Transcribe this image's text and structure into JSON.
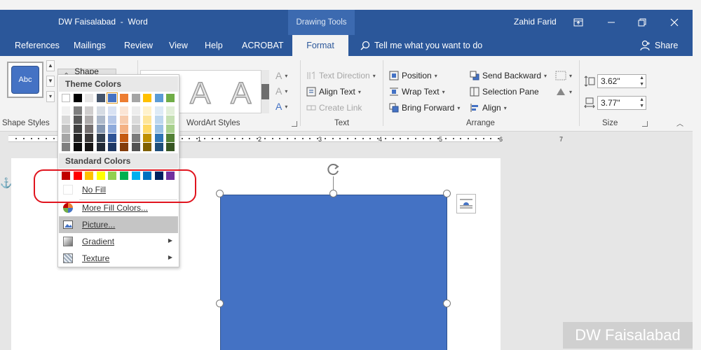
{
  "title_bar": {
    "document_title": "DW Faisalabad  -  Word",
    "contextual_tab_group": "Drawing Tools",
    "user_name": "Zahid Farid"
  },
  "tabs": [
    {
      "label": "References"
    },
    {
      "label": "Mailings"
    },
    {
      "label": "Review"
    },
    {
      "label": "View"
    },
    {
      "label": "Help"
    },
    {
      "label": "ACROBAT"
    },
    {
      "label": "Format",
      "active": true
    }
  ],
  "tell_me": "Tell me what you want to do",
  "share_label": "Share",
  "ribbon": {
    "shape_styles": {
      "label": "Shape Styles",
      "preview_text": "Abc",
      "shape_fill_label": "Shape Fill"
    },
    "wordart_styles": {
      "label": "WordArt Styles",
      "letter": "A"
    },
    "text": {
      "label": "Text",
      "text_direction": "Text Direction",
      "align_text": "Align Text",
      "create_link": "Create Link"
    },
    "arrange": {
      "label": "Arrange",
      "position": "Position",
      "wrap_text": "Wrap Text",
      "bring_forward": "Bring Forward",
      "send_backward": "Send Backward",
      "selection_pane": "Selection Pane",
      "align": "Align"
    },
    "size": {
      "label": "Size",
      "height": "3.62\"",
      "width": "3.77\""
    }
  },
  "ruler_numbers": [
    "1",
    "2",
    "3",
    "4",
    "5",
    "6",
    "7"
  ],
  "shape_fill_menu": {
    "theme_colors_label": "Theme Colors",
    "theme_colors_top": [
      "#ffffff",
      "#000000",
      "#e7e6e6",
      "#44546a",
      "#4472c4",
      "#ed7d31",
      "#a5a5a5",
      "#ffc000",
      "#5b9bd5",
      "#70ad47"
    ],
    "theme_shades": [
      [
        "#f2f2f2",
        "#7f7f7f",
        "#d0cece",
        "#d6dce4",
        "#d9e2f3",
        "#fbe5d5",
        "#ededed",
        "#fff2cc",
        "#deebf6",
        "#e2efd9"
      ],
      [
        "#d8d8d8",
        "#595959",
        "#aeabab",
        "#adb9ca",
        "#b4c6e7",
        "#f7cbac",
        "#dbdbdb",
        "#fee599",
        "#bdd7ee",
        "#c5e0b3"
      ],
      [
        "#bfbfbf",
        "#3f3f3f",
        "#757070",
        "#8496b0",
        "#8eaadb",
        "#f4b183",
        "#c9c9c9",
        "#ffd965",
        "#9cc3e5",
        "#a8d08d"
      ],
      [
        "#a5a5a5",
        "#262626",
        "#3a3838",
        "#323f4f",
        "#2f5496",
        "#c55a11",
        "#7b7b7b",
        "#bf9000",
        "#2e75b5",
        "#538135"
      ],
      [
        "#7f7f7f",
        "#0c0c0c",
        "#171616",
        "#222a35",
        "#1f3864",
        "#833c0b",
        "#525252",
        "#7f6000",
        "#1e4e79",
        "#375623"
      ]
    ],
    "standard_colors_label": "Standard Colors",
    "standard_colors": [
      "#c00000",
      "#ff0000",
      "#ffc000",
      "#ffff00",
      "#92d050",
      "#00b050",
      "#00b0f0",
      "#0070c0",
      "#002060",
      "#7030a0"
    ],
    "items": {
      "no_fill": "No Fill",
      "more_fill_colors": "More Fill Colors...",
      "picture": "Picture...",
      "gradient": "Gradient",
      "texture": "Texture"
    }
  },
  "colors": {
    "brand_blue": "#2b579a",
    "shape_fill": "#4472c4",
    "highlight_red": "#e0141e"
  },
  "watermark": "DW Faisalabad"
}
